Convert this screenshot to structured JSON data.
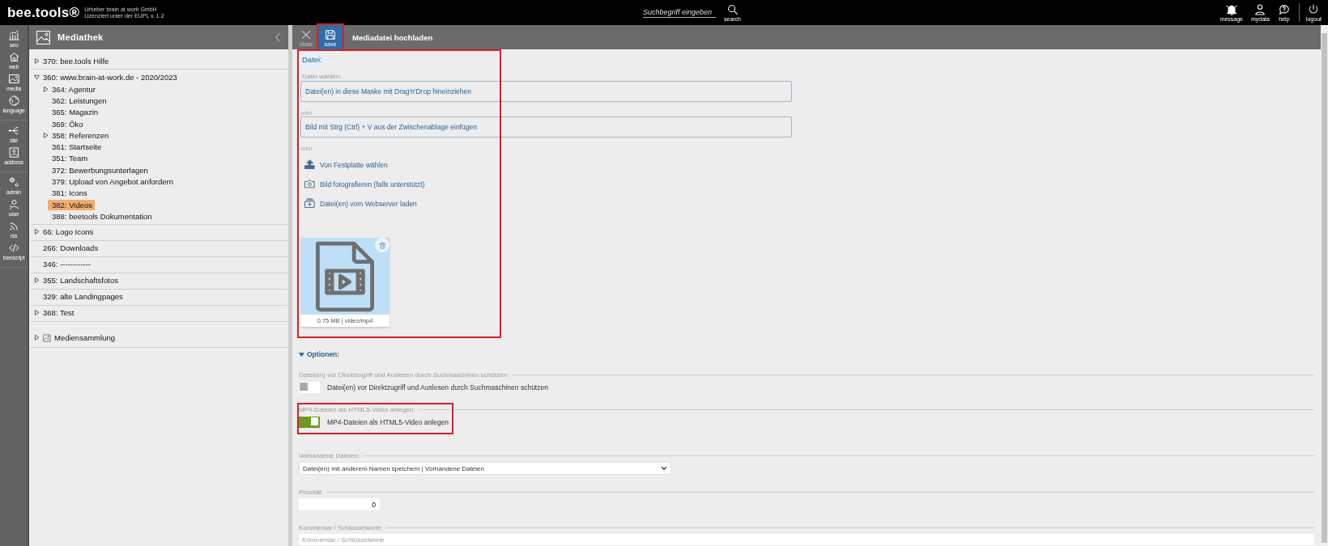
{
  "app": {
    "logo": "bee.tools®",
    "credits": [
      "Urheber brain at work GmbH",
      "Lizenziert unter der EUPL v. 1.2"
    ]
  },
  "search": {
    "placeholder": "Suchbegriff eingeben",
    "button": "search"
  },
  "top_actions": [
    {
      "label": "message",
      "kind": "bell"
    },
    {
      "label": "mydata",
      "kind": "person"
    },
    {
      "label": "help",
      "kind": "help"
    },
    {
      "label": "logout",
      "kind": "power"
    }
  ],
  "rail": [
    [
      {
        "label": "seo",
        "kind": "chart"
      },
      {
        "label": "web",
        "kind": "home"
      },
      {
        "label": "media",
        "kind": "image"
      },
      {
        "label": "language",
        "kind": "globe"
      }
    ],
    [
      {
        "label": "site",
        "kind": "sitemap"
      },
      {
        "label": "address",
        "kind": "contact"
      }
    ],
    [
      {
        "label": "admin",
        "kind": "gears"
      },
      {
        "label": "user",
        "kind": "user"
      },
      {
        "label": "rss",
        "kind": "rss"
      },
      {
        "label": "beescript",
        "kind": "code"
      }
    ]
  ],
  "library": {
    "title": "Mediathek",
    "tree": [
      {
        "label": "370: bee.tools Hilfe",
        "expanded": false,
        "selected": false
      },
      {
        "label": "360: www.brain-at-work.de - 2020/2023",
        "expanded": true,
        "selected": false,
        "children": [
          {
            "label": "364: Agentur",
            "expanded": false,
            "selected": false
          },
          {
            "label": "362: Leistungen",
            "selected": false
          },
          {
            "label": "365: Magazin",
            "selected": false
          },
          {
            "label": "369: Öko",
            "selected": false
          },
          {
            "label": "358: Referenzen",
            "expanded": false,
            "selected": false
          },
          {
            "label": "361: Startseite",
            "selected": false
          },
          {
            "label": "351: Team",
            "selected": false
          },
          {
            "label": "372: Bewerbungsunterlagen",
            "selected": false
          },
          {
            "label": "379: Upload von Angebot anfordern",
            "selected": false
          },
          {
            "label": "381: Icons",
            "selected": false
          },
          {
            "label": "382: Videos",
            "selected": true
          },
          {
            "label": "388: beetools Dokumentation",
            "selected": false
          }
        ]
      },
      {
        "label": "66: Logo Icons",
        "expanded": false,
        "selected": false
      },
      {
        "label": "266: Downloads",
        "selected": false
      },
      {
        "label": "346: ------------",
        "selected": false
      },
      {
        "label": "355: Landschaftsfotos",
        "expanded": false,
        "selected": false
      },
      {
        "label": "329: alte Landingpages",
        "selected": false
      },
      {
        "label": "368: Test",
        "expanded": false,
        "selected": false
      }
    ],
    "collection": {
      "label": "Mediensammlung",
      "expanded": false
    }
  },
  "editor": {
    "title": "Mediadatei hochladen",
    "toolbar": [
      {
        "label": "close",
        "kind": "close",
        "selected": false,
        "highlighted": false
      },
      {
        "label": "save",
        "kind": "save",
        "selected": true,
        "highlighted": true
      }
    ],
    "file_section": {
      "heading": "Datei:",
      "highlighted": true,
      "choose_label": "Datei wählen:",
      "dropzone": "Datei(en) in diese Maske mit Drag'n'Drop hineinziehen",
      "or_1": "oder",
      "paste_zone": "Bild mit Strg (Ctrl) + V aus der Zwischenablage einfügen",
      "or_2": "oder",
      "actions": [
        {
          "label": "Von Festplatte wählen",
          "kind": "upload"
        },
        {
          "label": "Bild fotografieren (falls unterstützt)",
          "kind": "camera"
        },
        {
          "label": "Datei(en) vom Webserver laden",
          "kind": "server"
        }
      ],
      "preview": {
        "caption": "0.75 MB | video/mp4"
      }
    },
    "options": {
      "heading": "Optionen:",
      "expanded": true,
      "toggles": [
        {
          "legend": "Datei(en) vor Direktzugriff und Auslesen durch Suchmaschinen schützen:",
          "label": "Datei(en) vor Direktzugriff und Auslesen durch Suchmaschinen schützen",
          "on": false,
          "highlighted": false
        },
        {
          "legend": "MP4-Dateien als HTML5-Video anlegen:",
          "label": "MP4-Dateien als HTML5-Video anlegen",
          "on": true,
          "highlighted": true
        }
      ],
      "existing": {
        "legend": "Vorhandene Dateien:",
        "value": "Datei(en) mit anderem Namen speichern | Vorhandene Dateien"
      },
      "priority": {
        "legend": "Priorität:",
        "value": "0"
      },
      "comment": {
        "legend": "Kommentar / Schlüsselworte:",
        "placeholder": "Kommentar / Schlüsselworte"
      }
    }
  }
}
